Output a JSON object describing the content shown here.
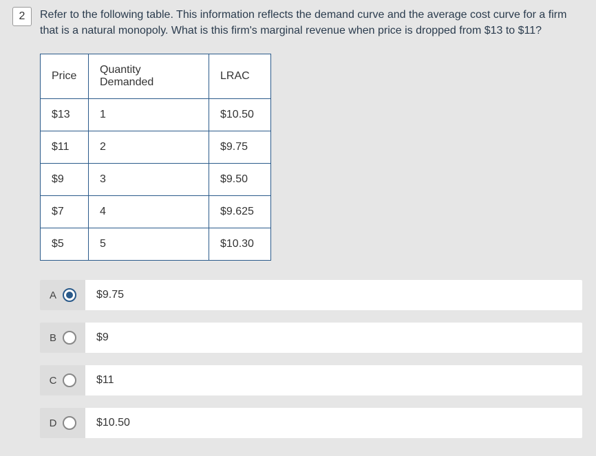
{
  "question": {
    "number": "2",
    "text": "Refer to the following table. This information reflects the demand curve and the average cost curve for a firm that is a natural monopoly. What is this firm's marginal revenue when price is dropped from $13 to $11?"
  },
  "table": {
    "headers": {
      "price": "Price",
      "quantity": "Quantity Demanded",
      "lrac": "LRAC"
    },
    "rows": [
      {
        "price": "$13",
        "quantity": "1",
        "lrac": "$10.50"
      },
      {
        "price": "$11",
        "quantity": "2",
        "lrac": "$9.75"
      },
      {
        "price": "$9",
        "quantity": "3",
        "lrac": "$9.50"
      },
      {
        "price": "$7",
        "quantity": "4",
        "lrac": "$9.625"
      },
      {
        "price": "$5",
        "quantity": "5",
        "lrac": "$10.30"
      }
    ]
  },
  "answers": [
    {
      "letter": "A",
      "text": "$9.75",
      "selected": true
    },
    {
      "letter": "B",
      "text": "$9",
      "selected": false
    },
    {
      "letter": "C",
      "text": "$11",
      "selected": false
    },
    {
      "letter": "D",
      "text": "$10.50",
      "selected": false
    }
  ]
}
